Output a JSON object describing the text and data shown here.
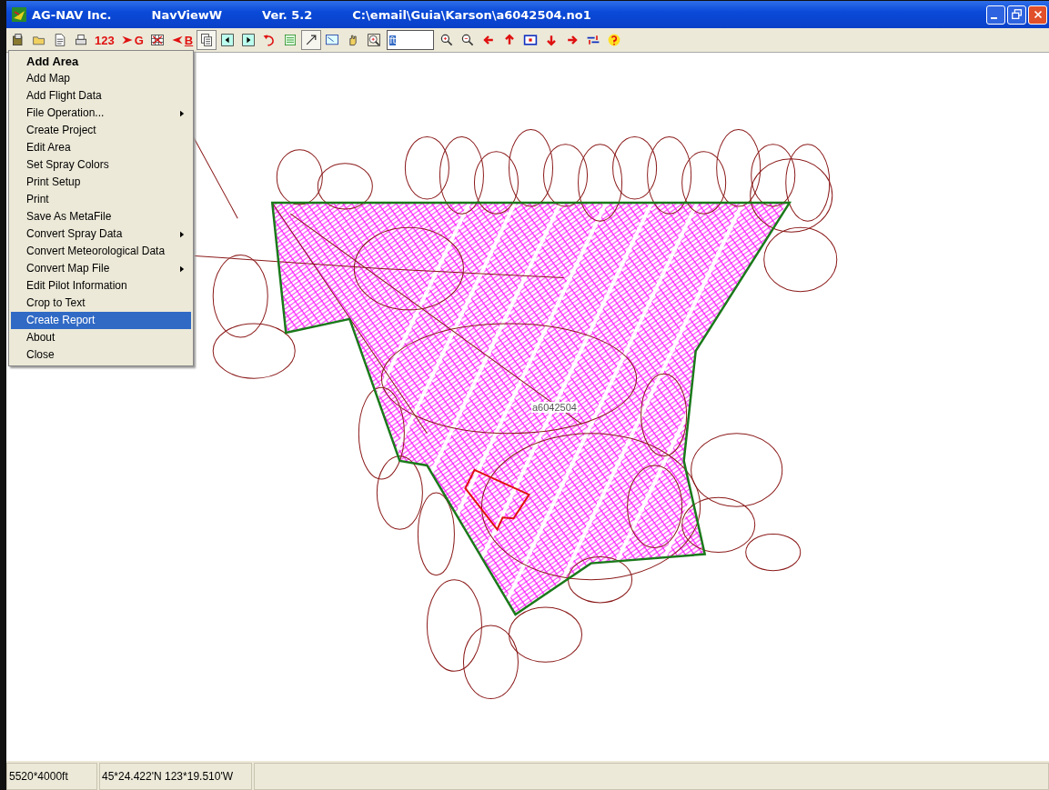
{
  "window": {
    "title_parts": [
      "AG-NAV Inc.",
      "NavViewW",
      "Ver. 5.2",
      "C:\\email\\Guia\\Karson\\a6042504.no1"
    ]
  },
  "toolbar": [
    {
      "kind": "save"
    },
    {
      "kind": "open"
    },
    {
      "kind": "document"
    },
    {
      "kind": "print"
    },
    {
      "kind": "text",
      "label": "123"
    },
    {
      "kind": "arrow-text",
      "label": "G"
    },
    {
      "kind": "grid"
    },
    {
      "kind": "back-text",
      "label": "B"
    },
    {
      "kind": "pages",
      "pressed": true
    },
    {
      "kind": "prev"
    },
    {
      "kind": "next"
    },
    {
      "kind": "undo"
    },
    {
      "kind": "list"
    },
    {
      "kind": "pointer",
      "pressed": true
    },
    {
      "kind": "zoom-rect"
    },
    {
      "kind": "hand"
    },
    {
      "kind": "zoom-box"
    },
    {
      "kind": "field",
      "value": "ft"
    },
    {
      "kind": "zoom-in"
    },
    {
      "kind": "zoom-out"
    },
    {
      "kind": "left"
    },
    {
      "kind": "up"
    },
    {
      "kind": "square"
    },
    {
      "kind": "down"
    },
    {
      "kind": "right"
    },
    {
      "kind": "adjust"
    },
    {
      "kind": "help"
    }
  ],
  "menu": [
    {
      "label": "Add Area",
      "default": true,
      "submenu": false,
      "selected": false
    },
    {
      "label": "Add Map",
      "default": false,
      "submenu": false,
      "selected": false
    },
    {
      "label": "Add Flight Data",
      "default": false,
      "submenu": false,
      "selected": false
    },
    {
      "label": "File Operation...",
      "default": false,
      "submenu": true,
      "selected": false
    },
    {
      "label": "Create Project",
      "default": false,
      "submenu": false,
      "selected": false
    },
    {
      "label": "Edit Area",
      "default": false,
      "submenu": false,
      "selected": false
    },
    {
      "label": "Set Spray Colors",
      "default": false,
      "submenu": false,
      "selected": false
    },
    {
      "label": "Print Setup",
      "default": false,
      "submenu": false,
      "selected": false
    },
    {
      "label": "Print",
      "default": false,
      "submenu": false,
      "selected": false
    },
    {
      "label": "Save As MetaFile",
      "default": false,
      "submenu": false,
      "selected": false
    },
    {
      "label": "Convert Spray Data",
      "default": false,
      "submenu": true,
      "selected": false
    },
    {
      "label": "Convert Meteorological Data",
      "default": false,
      "submenu": false,
      "selected": false
    },
    {
      "label": "Convert Map File",
      "default": false,
      "submenu": true,
      "selected": false
    },
    {
      "label": "Edit Pilot Information",
      "default": false,
      "submenu": false,
      "selected": false
    },
    {
      "label": "Crop to Text",
      "default": false,
      "submenu": false,
      "selected": false
    },
    {
      "label": "Create Report",
      "default": false,
      "submenu": false,
      "selected": true
    },
    {
      "label": "About",
      "default": false,
      "submenu": false,
      "selected": false
    },
    {
      "label": "Close",
      "default": false,
      "submenu": false,
      "selected": false
    }
  ],
  "map": {
    "area_label": "a6042504"
  },
  "status_bar": [
    "5520*4000ft",
    "45*24.422'N 123*19.510'W"
  ]
}
